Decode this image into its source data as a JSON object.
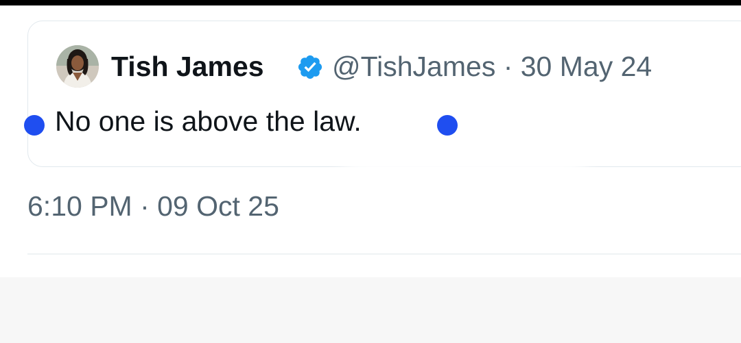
{
  "quoted_tweet": {
    "author_name": "Tish James",
    "verified_badge": "verified-badge-icon",
    "handle_and_date": "@TishJames · 30 May 24",
    "text": "No one is above the law."
  },
  "tweet_meta": {
    "timestamp": "6:10 PM · 09 Oct 25"
  },
  "colors": {
    "text_primary": "#0f1419",
    "text_secondary": "#536471",
    "verified_blue": "#1d9bf0",
    "annotation_dot": "#1f4ef0"
  }
}
